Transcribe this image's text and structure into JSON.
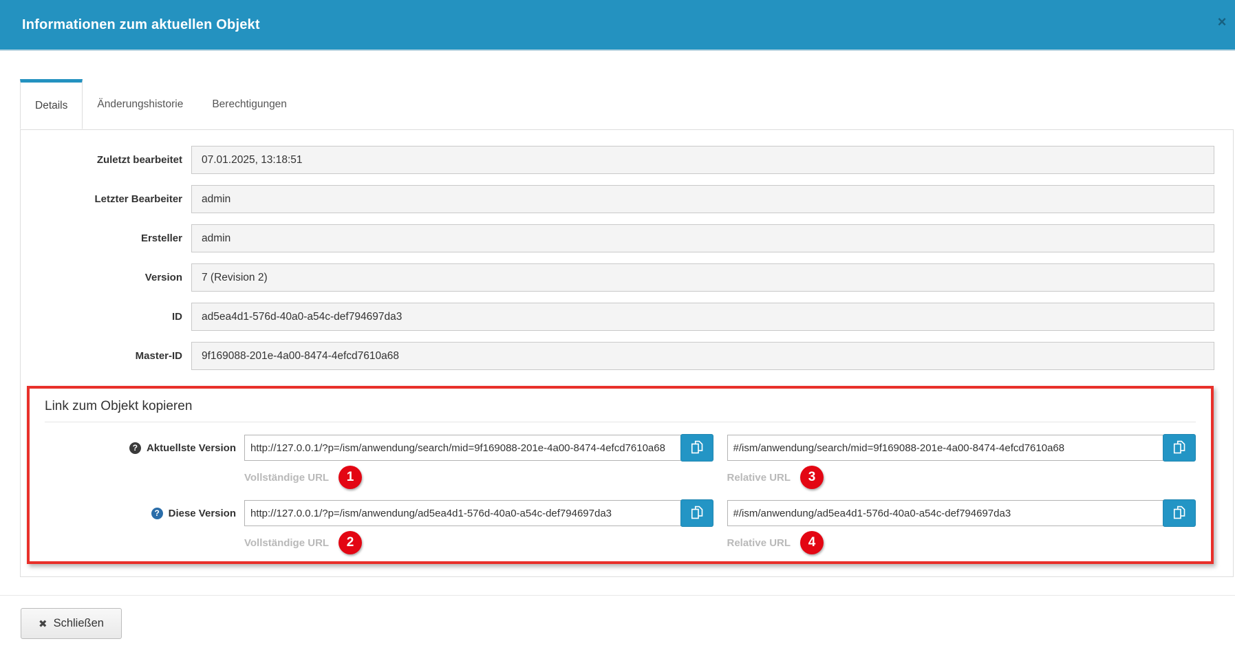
{
  "header": {
    "title": "Informationen zum aktuellen Objekt",
    "close_icon": "×"
  },
  "tabs": [
    {
      "label": "Details",
      "active": true
    },
    {
      "label": "Änderungshistorie",
      "active": false
    },
    {
      "label": "Berechtigungen",
      "active": false
    }
  ],
  "details": {
    "rows": [
      {
        "label": "Zuletzt bearbeitet",
        "value": "07.01.2025, 13:18:51"
      },
      {
        "label": "Letzter Bearbeiter",
        "value": "admin"
      },
      {
        "label": "Ersteller",
        "value": "admin"
      },
      {
        "label": "Version",
        "value": "7 (Revision 2)"
      },
      {
        "label": "ID",
        "value": "ad5ea4d1-576d-40a0-a54c-def794697da3"
      },
      {
        "label": "Master-ID",
        "value": "9f169088-201e-4a00-8474-4efcd7610a68"
      }
    ]
  },
  "link_section": {
    "title": "Link zum Objekt kopieren",
    "help_icon_glyph": "?",
    "rows": [
      {
        "label": "Aktuellste Version",
        "full": {
          "value": "http://127.0.0.1/?p=/ism/anwendung/search/mid=9f169088-201e-4a00-8474-4efcd7610a68",
          "caption": "Vollständige URL",
          "badge": "1"
        },
        "relative": {
          "value": "#/ism/anwendung/search/mid=9f169088-201e-4a00-8474-4efcd7610a68",
          "caption": "Relative URL",
          "badge": "3"
        }
      },
      {
        "label": "Diese Version",
        "full": {
          "value": "http://127.0.0.1/?p=/ism/anwendung/ad5ea4d1-576d-40a0-a54c-def794697da3",
          "caption": "Vollständige URL",
          "badge": "2"
        },
        "relative": {
          "value": "#/ism/anwendung/ad5ea4d1-576d-40a0-a54c-def794697da3",
          "caption": "Relative URL",
          "badge": "4"
        }
      }
    ]
  },
  "footer": {
    "close_icon": "✖",
    "close_label": "Schließen"
  },
  "colors": {
    "header_teal": "#2492c0",
    "copy_button_blue": "#2395c5",
    "annotation_red": "#e8302a",
    "badge_red": "#e30613",
    "panel_border": "#dddddd",
    "readonly_field_bg": "#f4f4f4"
  }
}
